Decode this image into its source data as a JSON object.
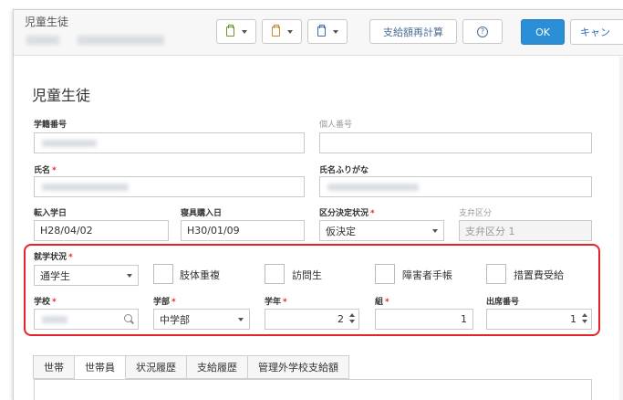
{
  "window": {
    "title": "児童生徒"
  },
  "toolbar": {
    "recalc_label": "支給額再計算",
    "ok_label": "OK",
    "cancel_label": "キャン"
  },
  "page": {
    "title": "児童生徒"
  },
  "fields": {
    "student_no": {
      "label": "学籍番号"
    },
    "personal_no": {
      "label": "個人番号"
    },
    "name": {
      "label": "氏名"
    },
    "kana": {
      "label": "氏名ふりがな"
    },
    "transfer_date": {
      "label": "転入学日",
      "value": "H28/04/02"
    },
    "bed_date": {
      "label": "寝具購入日",
      "value": "H30/01/09"
    },
    "status": {
      "label": "区分決定状況",
      "value": "仮決定"
    },
    "payment_cat": {
      "label": "支弁区分",
      "value": "支弁区分 1"
    }
  },
  "enrollment": {
    "label": "就学状況",
    "value": "通学生",
    "checkboxes": [
      "肢体重複",
      "訪問生",
      "障害者手帳",
      "措置費受給"
    ],
    "school_label": "学校",
    "dept_label": "学部",
    "dept_value": "中学部",
    "grade_label": "学年",
    "grade_value": "2",
    "class_label": "組",
    "class_value": "1",
    "seat_label": "出席番号",
    "seat_value": "1"
  },
  "tabs": [
    "世帯",
    "世帯員",
    "状況履歴",
    "支給履歴",
    "管理外学校支給額"
  ],
  "active_tab": "世帯員",
  "colors": {
    "accent": "#2a8fd6",
    "required": "#e23333",
    "highlight": "#e4242b"
  }
}
